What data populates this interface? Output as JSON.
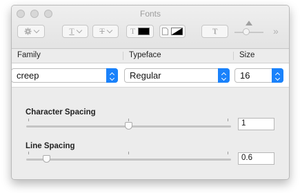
{
  "window": {
    "title": "Fonts"
  },
  "toolbar": {
    "action_icon": "gear-icon",
    "underline_glyph": "T",
    "strikethrough_glyph": "T",
    "text_color_glyph": "T",
    "text_color": "#000000",
    "document_color_icon": "document-icon",
    "shadow_glyph": "T",
    "more_glyph": "»"
  },
  "columns": {
    "family": "Family",
    "typeface": "Typeface",
    "size": "Size"
  },
  "selection": {
    "family": "creep",
    "typeface": "Regular",
    "size": "16"
  },
  "character_spacing": {
    "label": "Character Spacing",
    "value": "1",
    "slider_fraction": 0.5
  },
  "line_spacing": {
    "label": "Line Spacing",
    "value": "0.6",
    "slider_fraction": 0.1
  },
  "colors": {
    "accent": "#1a82fb"
  }
}
